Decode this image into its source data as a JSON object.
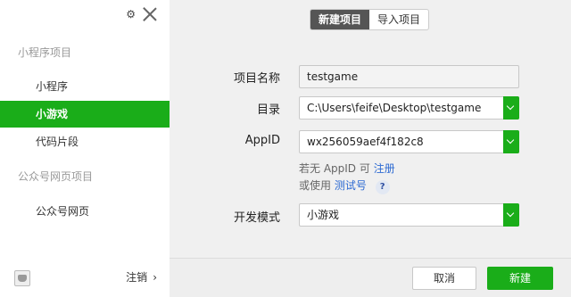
{
  "sidebar": {
    "section_miniprogram": "小程序项目",
    "items": [
      {
        "label": "小程序"
      },
      {
        "label": "小游戏"
      },
      {
        "label": "代码片段"
      }
    ],
    "section_official": "公众号网页项目",
    "official_item": "公众号网页",
    "logout_label": "注销",
    "logout_chevron": "›",
    "gear": "⚙"
  },
  "main": {
    "tabs": [
      {
        "label": "新建项目"
      },
      {
        "label": "导入项目"
      }
    ],
    "project_name_label": "项目名称",
    "project_name_value": "testgame",
    "directory_label": "目录",
    "directory_value": "C:\\Users\\feife\\Desktop\\testgame",
    "appid_label": "AppID",
    "appid_value": "wx256059aef4f182c8",
    "hint1_prefix": "若无 AppID 可",
    "hint1_link": "注册",
    "hint2_prefix": "或使用",
    "hint2_link": "测试号",
    "hint2_help": "?",
    "mode_label": "开发模式",
    "mode_value": "小游戏",
    "cancel_label": "取消",
    "create_label": "新建"
  },
  "colors": {
    "accent": "#1aad19",
    "link": "#2d6ad2",
    "tab_active": "#555555"
  }
}
